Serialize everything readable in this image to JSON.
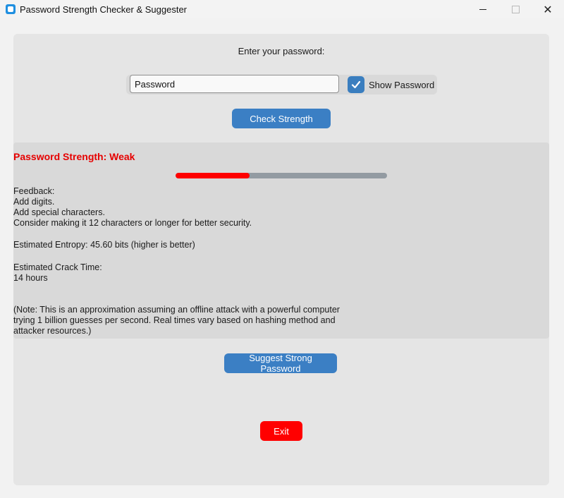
{
  "window": {
    "title": "Password Strength Checker & Suggester",
    "controls": {
      "minimize": "—",
      "maximize": "☐",
      "close": "✕"
    }
  },
  "input_section": {
    "prompt": "Enter your password:",
    "password_value": "Password",
    "show_password_label": "Show Password",
    "show_password_checked": true,
    "check_button_label": "Check Strength"
  },
  "result": {
    "strength_title": "Password Strength: Weak",
    "strength_color": "#e60000",
    "progress_fraction": 0.35,
    "progress_color": "#ff0000",
    "feedback_heading": "Feedback:",
    "feedback_items": [
      "Add digits.",
      "Add special characters.",
      "Consider making it 12 characters or longer for better security."
    ],
    "entropy_text": "Estimated Entropy: 45.60 bits (higher is better)",
    "crack_time_heading": "Estimated Crack Time:",
    "crack_time_value": "14 hours",
    "note_lines": [
      "(Note: This is an approximation assuming an offline attack with a powerful computer",
      "trying 1 billion guesses per second. Real times vary based on hashing method and",
      "attacker resources.)"
    ]
  },
  "actions": {
    "suggest_button_label": "Suggest Strong Password",
    "exit_button_label": "Exit"
  },
  "colors": {
    "accent": "#3b7fc4",
    "exit": "#ff0000"
  }
}
